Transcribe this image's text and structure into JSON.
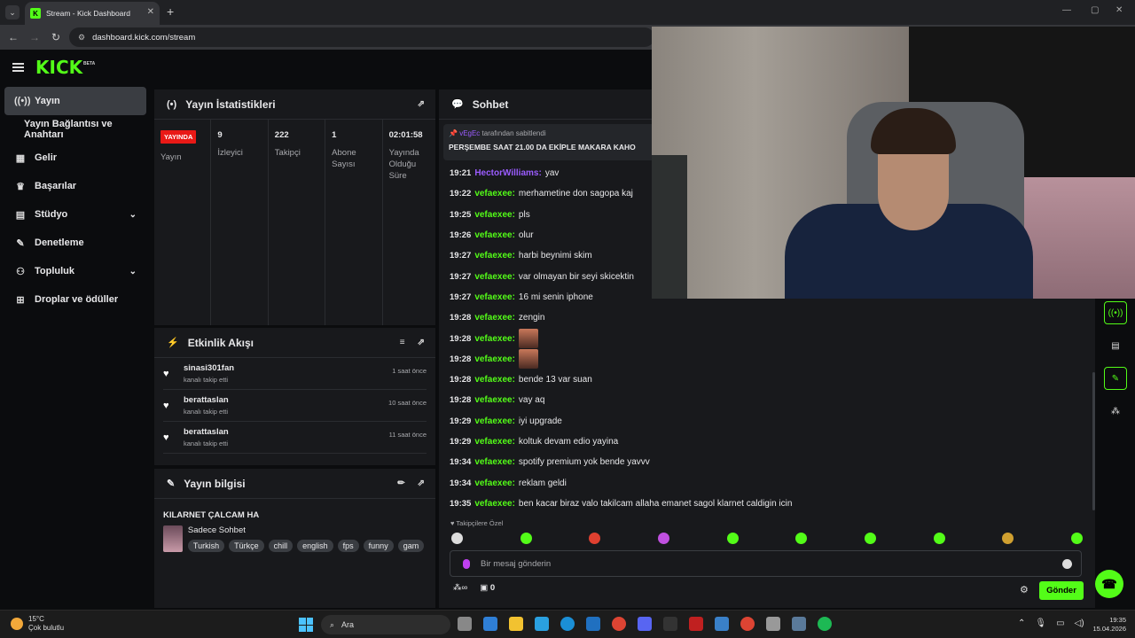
{
  "browser": {
    "tab_title": "Stream - Kick Dashboard",
    "url": "dashboard.kick.com/stream"
  },
  "header": {
    "logo": "KICK",
    "beta": "BETA"
  },
  "sidebar": {
    "items": [
      {
        "label": "Yayın",
        "icon": "broadcast-icon",
        "active": true
      },
      {
        "label": "Yayın Bağlantısı ve Anahtarı",
        "icon": "",
        "sub": true
      },
      {
        "label": "Gelir",
        "icon": "chart-icon"
      },
      {
        "label": "Başarılar",
        "icon": "trophy-icon"
      },
      {
        "label": "Stüdyo",
        "icon": "studio-icon",
        "expandable": true
      },
      {
        "label": "Denetleme",
        "icon": "wrench-icon"
      },
      {
        "label": "Topluluk",
        "icon": "community-icon",
        "expandable": true
      },
      {
        "label": "Droplar ve ödüller",
        "icon": "gift-icon"
      }
    ]
  },
  "stats": {
    "title": "Yayın İstatistikleri",
    "live_badge": "YAYINDA",
    "columns": [
      {
        "value": "",
        "label": "Yayın"
      },
      {
        "value": "9",
        "label": "İzleyici"
      },
      {
        "value": "222",
        "label": "Takipçi"
      },
      {
        "value": "1",
        "label": "Abone Sayısı"
      },
      {
        "value": "02:01:58",
        "label": "Yayında Olduğu Süre"
      }
    ]
  },
  "activity": {
    "title": "Etkinlik Akışı",
    "items": [
      {
        "name": "sinasi301fan",
        "action": "kanalı takip etti",
        "time": "1 saat önce"
      },
      {
        "name": "berattaslan",
        "action": "kanalı takip etti",
        "time": "10 saat önce"
      },
      {
        "name": "berattaslan",
        "action": "kanalı takip etti",
        "time": "11 saat önce"
      }
    ]
  },
  "info": {
    "title": "Yayın bilgisi",
    "stream_title": "KILARNET ÇALCAM HA",
    "category": "Sadece Sohbet",
    "tags": [
      "Turkish",
      "Türkçe",
      "chill",
      "english",
      "fps",
      "funny",
      "gam"
    ]
  },
  "chat": {
    "title": "Sohbet",
    "pinned_by": "vEgEc",
    "pinned_suffix": "tarafından sabitlendi",
    "pinned_message": "PERŞEMBE SAAT 21.00 DA EKİPLE MAKARA KAHO",
    "messages": [
      {
        "time": "19:21",
        "user": "HectorWilliams",
        "text": "yav",
        "purple": true
      },
      {
        "time": "19:22",
        "user": "vefaexee",
        "text": "merhametine don sagopa kaj"
      },
      {
        "time": "19:25",
        "user": "vefaexee",
        "text": "pls"
      },
      {
        "time": "19:26",
        "user": "vefaexee",
        "text": "olur"
      },
      {
        "time": "19:27",
        "user": "vefaexee",
        "text": "harbi beynimi skim"
      },
      {
        "time": "19:27",
        "user": "vefaexee",
        "text": "var olmayan bir seyi skicektin"
      },
      {
        "time": "19:27",
        "user": "vefaexee",
        "text": "16 mi senin iphone"
      },
      {
        "time": "19:28",
        "user": "vefaexee",
        "text": "zengin"
      },
      {
        "time": "19:28",
        "user": "vefaexee",
        "text": "",
        "emote": true
      },
      {
        "time": "19:28",
        "user": "vefaexee",
        "text": "",
        "emote": true
      },
      {
        "time": "19:28",
        "user": "vefaexee",
        "text": "bende 13 var suan"
      },
      {
        "time": "19:28",
        "user": "vefaexee",
        "text": "vay aq"
      },
      {
        "time": "19:29",
        "user": "vefaexee",
        "text": "iyi upgrade"
      },
      {
        "time": "19:29",
        "user": "vefaexee",
        "text": "koltuk devam edio yayina"
      },
      {
        "time": "19:34",
        "user": "vefaexee",
        "text": "spotify premium yok bende yavvv"
      },
      {
        "time": "19:34",
        "user": "vefaexee",
        "text": "reklam geldi"
      },
      {
        "time": "19:35",
        "user": "vefaexee",
        "text": "ben kacar biraz valo takilcam allaha emanet sagol klarnet caldigin icin"
      }
    ],
    "followers_only": "Takipçilere Özel",
    "input_placeholder": "Bir mesaj gönderin",
    "points": "0",
    "send_label": "Gönder"
  },
  "taskbar": {
    "temp": "15°C",
    "weather": "Çok bulutlu",
    "search": "Ara",
    "time": "19:35",
    "date": "15.04.2026"
  },
  "colors": {
    "accent": "#53fc18",
    "live": "#e91916",
    "purple": "#9b5cff"
  }
}
